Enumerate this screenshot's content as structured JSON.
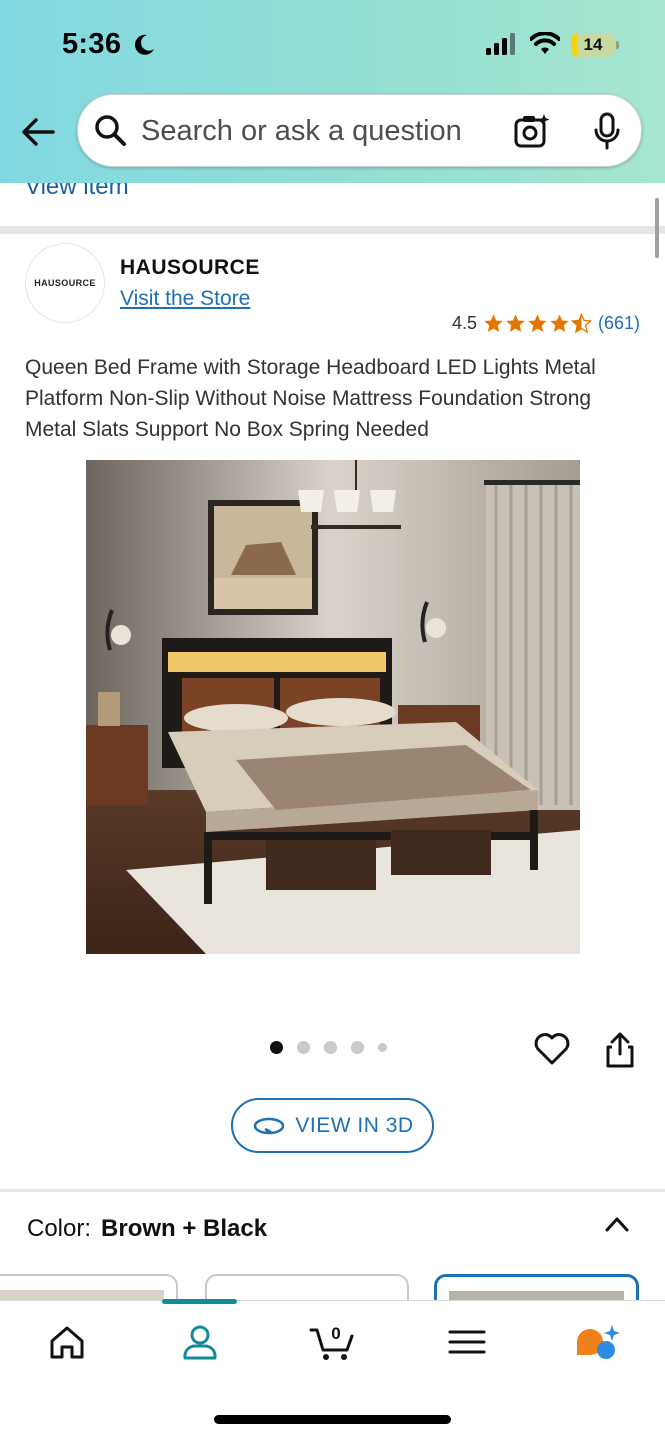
{
  "status_bar": {
    "time": "5:36",
    "battery": "14"
  },
  "search": {
    "placeholder": "Search or ask a question"
  },
  "previous_section": {
    "link": "View item"
  },
  "brand": {
    "logo_text": "HAUSOURCE",
    "name": "HAUSOURCE",
    "store_link": "Visit the Store"
  },
  "rating": {
    "value": "4.5",
    "count": "(661)",
    "stars": 4.5
  },
  "product": {
    "title": "Queen Bed Frame with Storage Headboard LED Lights Metal Platform Non-Slip Without Noise Mattress Foundation Strong Metal Slats Support No Box Spring Needed",
    "image_alt": "Bed frame with LED headboard in bedroom"
  },
  "gallery": {
    "count": 5,
    "active": 0
  },
  "view3d": {
    "label": "VIEW IN 3D"
  },
  "color": {
    "label": "Color:",
    "value": "Brown + Black"
  },
  "tabs": [
    {
      "name": "home",
      "icon": "home-icon"
    },
    {
      "name": "account",
      "icon": "person-icon",
      "active": true
    },
    {
      "name": "cart",
      "icon": "cart-icon",
      "count": "0"
    },
    {
      "name": "menu",
      "icon": "menu-icon"
    },
    {
      "name": "rufus",
      "icon": "assistant-icon"
    }
  ],
  "colors": {
    "accent": "#1f6fb5",
    "star": "#e77600",
    "tab_active": "#138a9a"
  }
}
